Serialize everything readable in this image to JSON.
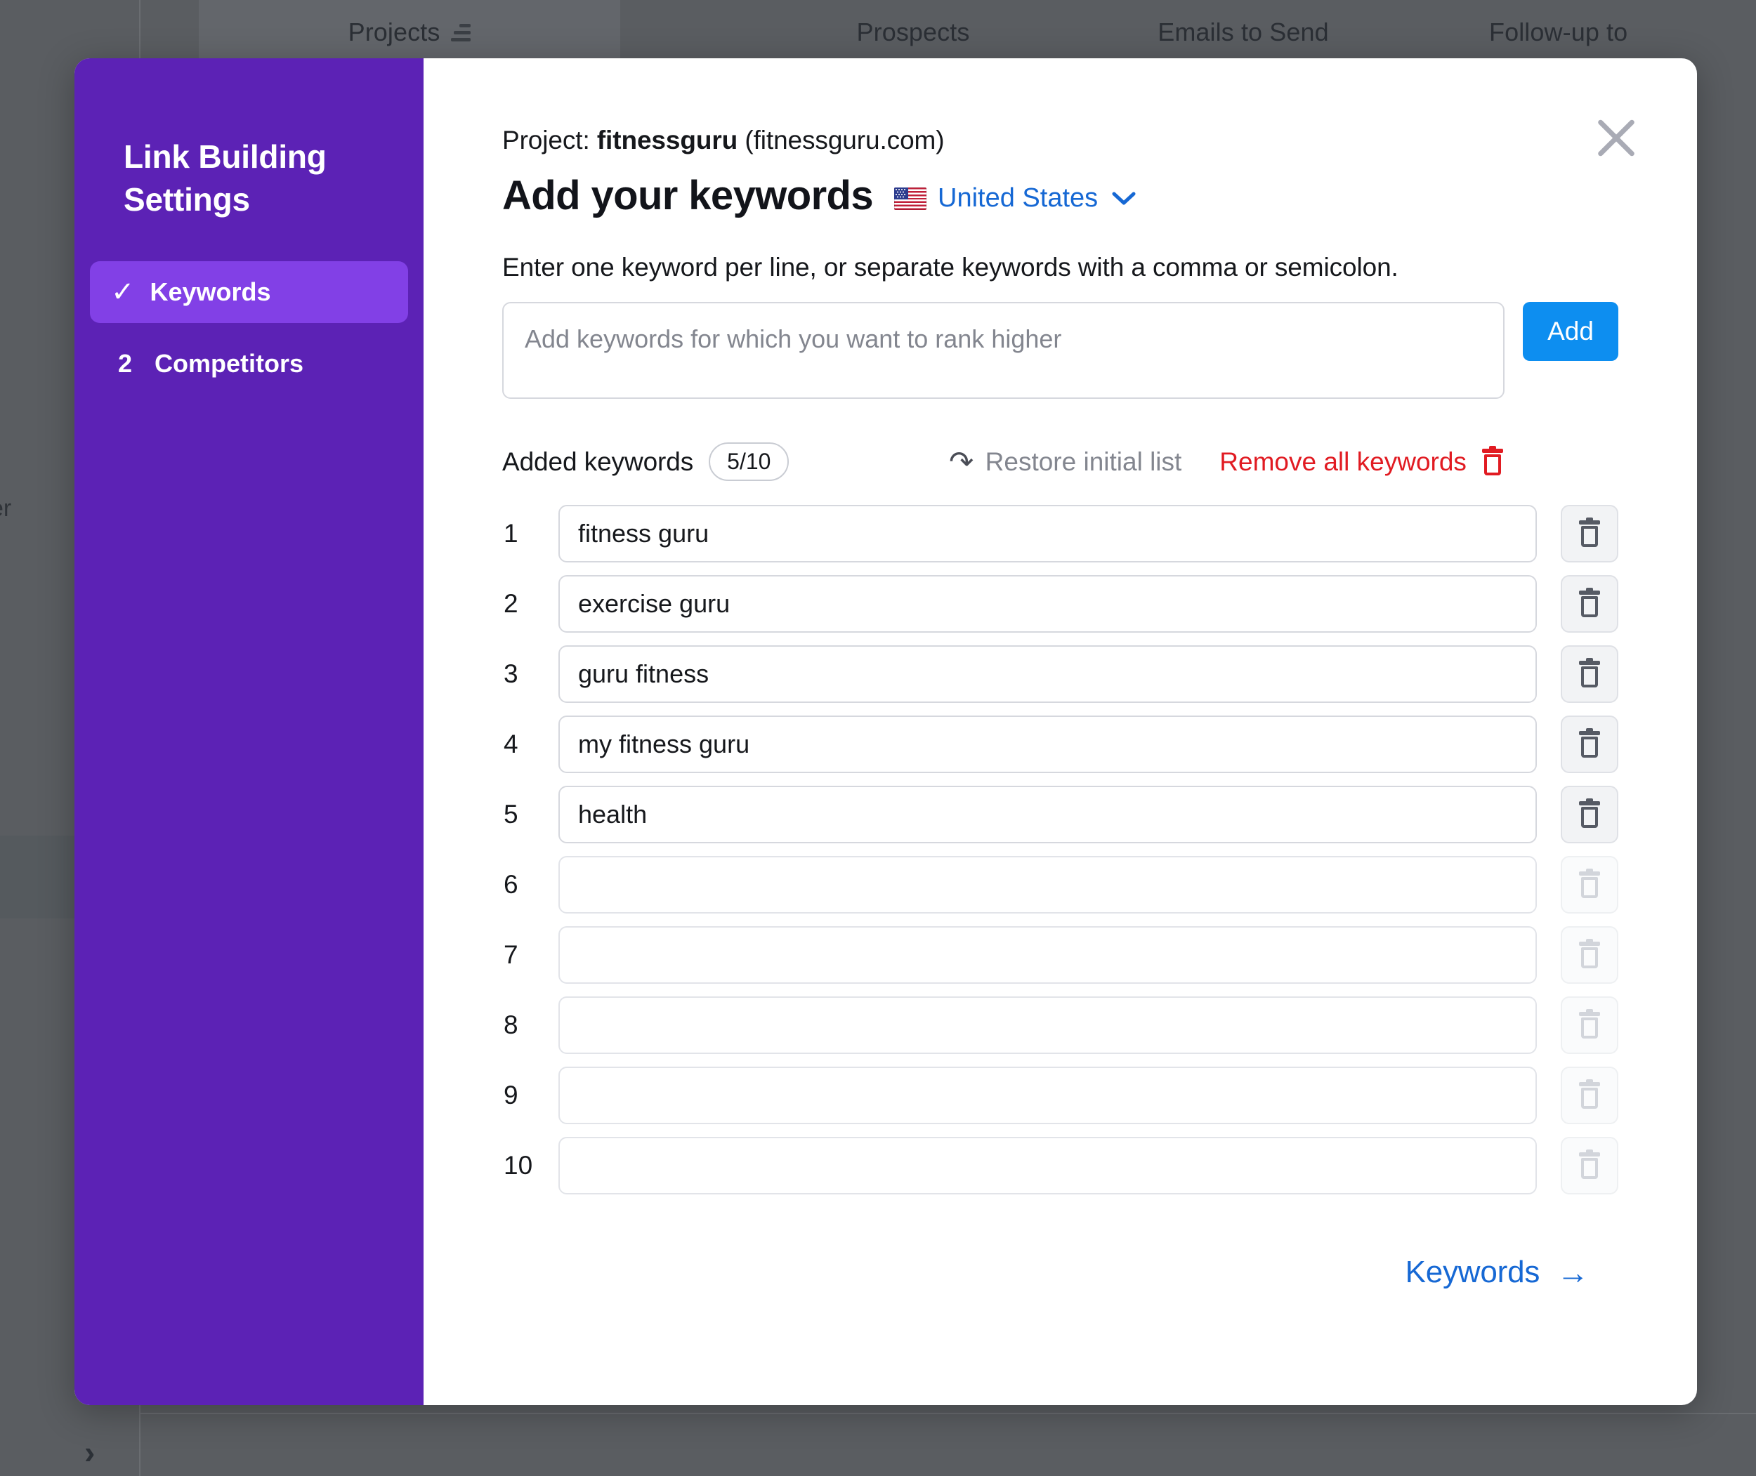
{
  "background": {
    "tabs": [
      {
        "label": "Projects",
        "icon": "list-icon",
        "active": true
      },
      {
        "label": "Prospects",
        "active": false
      },
      {
        "label": "Emails to Send",
        "active": false
      },
      {
        "label": "Follow-up to",
        "active": false
      }
    ],
    "cut_off_text": "er",
    "chevron_icon": "›"
  },
  "sidebar": {
    "title": "Link Building Settings",
    "items": [
      {
        "marker": "✓",
        "label": "Keywords",
        "active": true
      },
      {
        "marker": "2",
        "label": "Competitors",
        "active": false
      }
    ]
  },
  "modal": {
    "close_icon": "close-icon",
    "project_prefix": "Project:",
    "project_name": "fitnessguru",
    "project_domain": "(fitnessguru.com)",
    "title": "Add your keywords",
    "country": {
      "flag": "🇺🇸",
      "name": "United States",
      "chevron": "⌄"
    },
    "instructions": "Enter one keyword per line, or separate keywords with a comma or semicolon.",
    "keyword_input": {
      "placeholder": "Add keywords for which you want to rank higher",
      "value": ""
    },
    "add_button_label": "Add",
    "added_keywords_label": "Added keywords",
    "keyword_count": "5/10",
    "restore_label": "Restore initial list",
    "restore_icon": "↶",
    "remove_all_label": "Remove all keywords",
    "remove_all_icon": "trash-icon",
    "rows": [
      {
        "index": "1",
        "value": "fitness guru",
        "filled": true
      },
      {
        "index": "2",
        "value": "exercise guru",
        "filled": true
      },
      {
        "index": "3",
        "value": "guru fitness",
        "filled": true
      },
      {
        "index": "4",
        "value": "my fitness guru",
        "filled": true
      },
      {
        "index": "5",
        "value": "health",
        "filled": true
      },
      {
        "index": "6",
        "value": "",
        "filled": false
      },
      {
        "index": "7",
        "value": "",
        "filled": false
      },
      {
        "index": "8",
        "value": "",
        "filled": false
      },
      {
        "index": "9",
        "value": "",
        "filled": false
      },
      {
        "index": "10",
        "value": "",
        "filled": false
      }
    ],
    "next_label": "Keywords",
    "next_arrow": "→"
  },
  "colors": {
    "sidebar_purple": "#5c22b5",
    "sidebar_active_purple": "#8240e6",
    "accent_blue": "#0d8ef0",
    "link_blue": "#1668d4",
    "danger_red": "#e11b22",
    "overlay_gray": "#5a5d61"
  }
}
